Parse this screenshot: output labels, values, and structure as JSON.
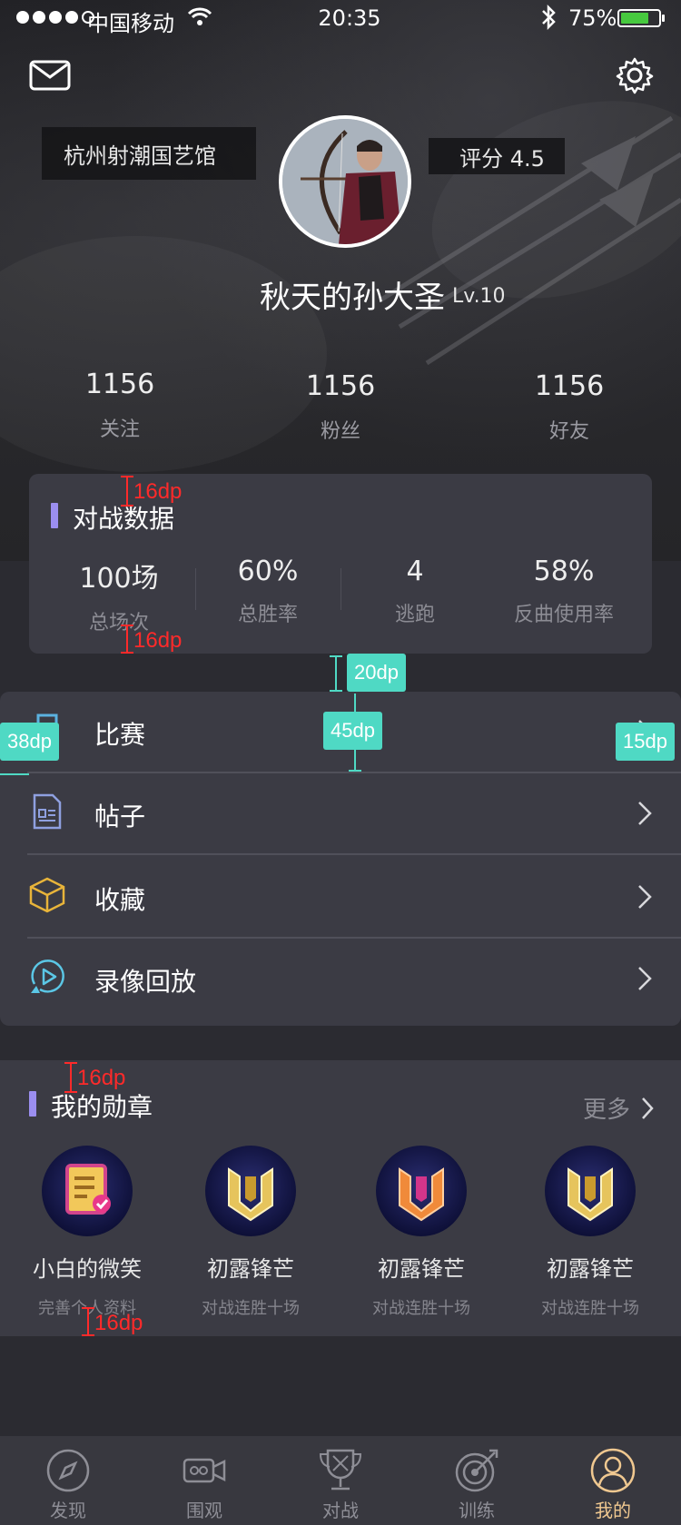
{
  "status_bar": {
    "carrier": "中国移动",
    "time": "20:35",
    "battery_pct": "75%",
    "battery_level": 0.75
  },
  "profile": {
    "club": "杭州射潮国艺馆",
    "rating": "评分 4.5",
    "name": "秋天的孙大圣",
    "level": "Lv.10",
    "stats": [
      {
        "value": "1156",
        "label": "关注"
      },
      {
        "value": "1156",
        "label": "粉丝"
      },
      {
        "value": "1156",
        "label": "好友"
      }
    ]
  },
  "battle": {
    "title": "对战数据",
    "items": [
      {
        "value": "100场",
        "label": "总场次"
      },
      {
        "value": "60%",
        "label": "总胜率"
      },
      {
        "value": "4",
        "label": "逃跑"
      },
      {
        "value": "58%",
        "label": "反曲使用率"
      }
    ]
  },
  "menu": [
    {
      "label": "比赛",
      "icon": "trophy-icon"
    },
    {
      "label": "帖子",
      "icon": "document-icon"
    },
    {
      "label": "收藏",
      "icon": "box-icon"
    },
    {
      "label": "录像回放",
      "icon": "replay-icon"
    }
  ],
  "medals": {
    "title": "我的勋章",
    "more": "更多",
    "items": [
      {
        "name": "小白的微笑",
        "desc": "完善个人资料"
      },
      {
        "name": "初露锋芒",
        "desc": "对战连胜十场"
      },
      {
        "name": "初露锋芒",
        "desc": "对战连胜十场"
      },
      {
        "name": "初露锋芒",
        "desc": "对战连胜十场"
      }
    ]
  },
  "tabs": [
    {
      "label": "发现",
      "icon": "compass-icon"
    },
    {
      "label": "围观",
      "icon": "video-icon"
    },
    {
      "label": "对战",
      "icon": "trophy-icon"
    },
    {
      "label": "训练",
      "icon": "target-icon"
    },
    {
      "label": "我的",
      "icon": "user-icon"
    }
  ],
  "annotations": {
    "spacing_16": "16dp",
    "spacing_20": "20dp",
    "spacing_45": "45dp",
    "spacing_38": "38dp",
    "spacing_15": "15dp"
  },
  "colors": {
    "accent": "#9b8ef0",
    "active_tab": "#f0c890",
    "annotation_teal": "#4fd9c4",
    "annotation_red": "#ff2a2a"
  }
}
